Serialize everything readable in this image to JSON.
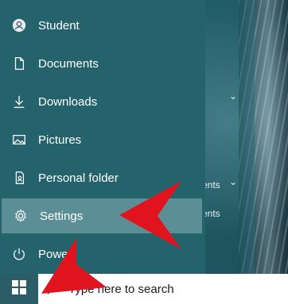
{
  "start_menu": {
    "items": [
      {
        "label": "Student",
        "icon": "user-avatar-icon"
      },
      {
        "label": "Documents",
        "icon": "document-icon"
      },
      {
        "label": "Downloads",
        "icon": "download-icon"
      },
      {
        "label": "Pictures",
        "icon": "picture-icon"
      },
      {
        "label": "Personal folder",
        "icon": "folder-icon"
      },
      {
        "label": "Settings",
        "icon": "gear-icon",
        "highlighted": true
      },
      {
        "label": "Power",
        "icon": "power-icon"
      }
    ]
  },
  "tiles": {
    "partial_1": "ents",
    "partial_2": "ents"
  },
  "taskbar": {
    "search_placeholder": "Type here to search"
  },
  "colors": {
    "menu_bg": "#24636c",
    "highlight_bg": "#5c8f95",
    "arrow": "#e0141e"
  }
}
